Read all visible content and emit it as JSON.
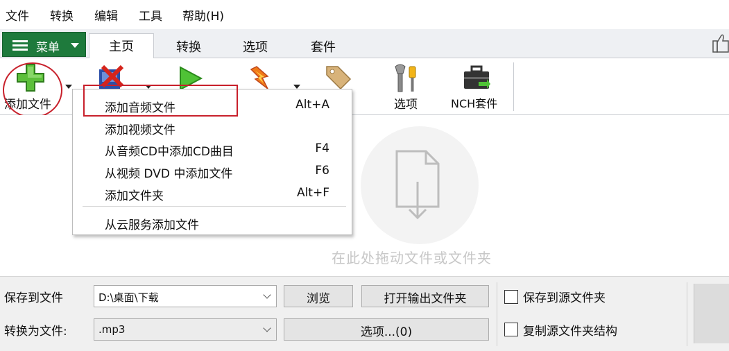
{
  "menubar": {
    "items": [
      "文件",
      "转换",
      "编辑",
      "工具",
      "帮助(H)"
    ]
  },
  "ribbon": {
    "menu_button": "菜单",
    "tabs": [
      "主页",
      "转换",
      "选项",
      "套件"
    ],
    "active_tab": "主页"
  },
  "toolbar": {
    "add_files": "添加文件",
    "options": "选项",
    "nch_suite": "NCH套件",
    "icons": [
      "plus-icon",
      "remove-file-icon",
      "play-icon",
      "burn-icon",
      "tag-icon",
      "wrench-screwdriver-icon",
      "briefcase-icon"
    ]
  },
  "dropdown": {
    "items": [
      {
        "label": "添加音频文件",
        "shortcut": "Alt+A"
      },
      {
        "label": "添加视频文件",
        "shortcut": ""
      },
      {
        "label": "从音频CD中添加CD曲目",
        "shortcut": "F4"
      },
      {
        "label": "从视频 DVD 中添加文件",
        "shortcut": "F6"
      },
      {
        "label": "添加文件夹",
        "shortcut": "Alt+F"
      },
      {
        "label": "从云服务添加文件",
        "shortcut": ""
      }
    ]
  },
  "droparea": {
    "hint": "在此处拖动文件或文件夹"
  },
  "bottom": {
    "save_to_label": "保存到文件",
    "save_to_value": "D:\\桌面\\下载",
    "browse": "浏览",
    "open_output": "打开输出文件夹",
    "save_to_source": "保存到源文件夹",
    "convert_to_label": "转换为文件:",
    "format_value": ".mp3",
    "options_button": "选项...(0)",
    "copy_structure": "复制源文件夹结构"
  },
  "colors": {
    "menu_green": "#1e7a3c",
    "annotation_red": "#c8202b"
  }
}
